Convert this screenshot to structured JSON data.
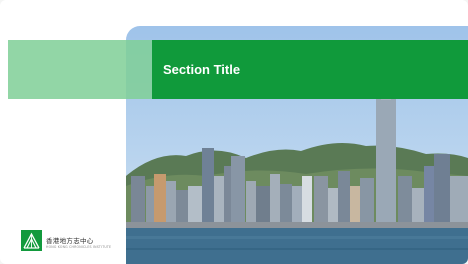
{
  "slide": {
    "section_title": "Section Title"
  },
  "logo": {
    "name_cn": "香港地方志中心",
    "name_en": "HONG KONG CHRONICLES INSTITUTE",
    "brand_color": "#129a3d"
  },
  "colors": {
    "title_band": "#109a3b",
    "accent_band": "#7fcf97",
    "sky": "#a8c9ec",
    "harbour": "#3f6f8f"
  },
  "photo": {
    "subject": "city-skyline-photo"
  }
}
